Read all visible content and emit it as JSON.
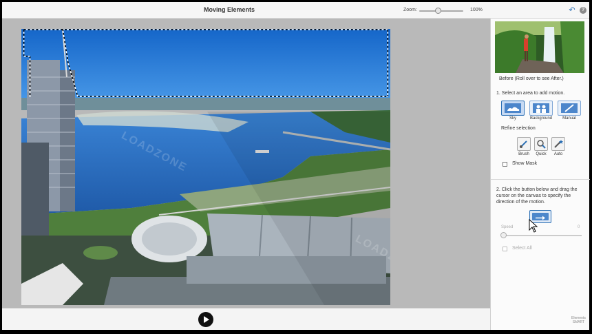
{
  "window": {
    "title": "Moving Elements"
  },
  "zoom": {
    "label": "Zoom:",
    "value": "100%",
    "level": 0.5
  },
  "watermark": "LOADZONE",
  "panel": {
    "before_label": "Before (Roll over to see After.)",
    "step1": "1. Select an area to add motion.",
    "modes": [
      {
        "label": "Sky",
        "icon": "sky-icon",
        "selected": true
      },
      {
        "label": "Background",
        "icon": "background-icon",
        "selected": false
      },
      {
        "label": "Manual",
        "icon": "manual-brush-icon",
        "selected": false
      }
    ],
    "refine_label": "Refine selection",
    "refine_tools": [
      {
        "label": "Brush",
        "icon": "brush-icon"
      },
      {
        "label": "Quick",
        "icon": "quick-select-icon"
      },
      {
        "label": "Auto",
        "icon": "magic-wand-icon"
      }
    ],
    "show_mask": "Show Mask",
    "step2": "2. Click the button below and drag the cursor on the canvas to specify the direction of the motion.",
    "speed_label": "Speed",
    "speed_max": "0",
    "select_all": "Select All",
    "footer_logo_line1": "Elements",
    "footer_logo_line2": "SMART"
  },
  "icons": {
    "undo": "undo-icon",
    "help": "help-icon",
    "play": "play-icon",
    "motion_arrow": "arrow-right-icon",
    "cursor": "pointer-cursor-icon"
  },
  "colors": {
    "accent": "#2a6fb5",
    "sky": "#1e7fe0",
    "water": "#2c6fc1",
    "greenery": "#3f7a35"
  }
}
